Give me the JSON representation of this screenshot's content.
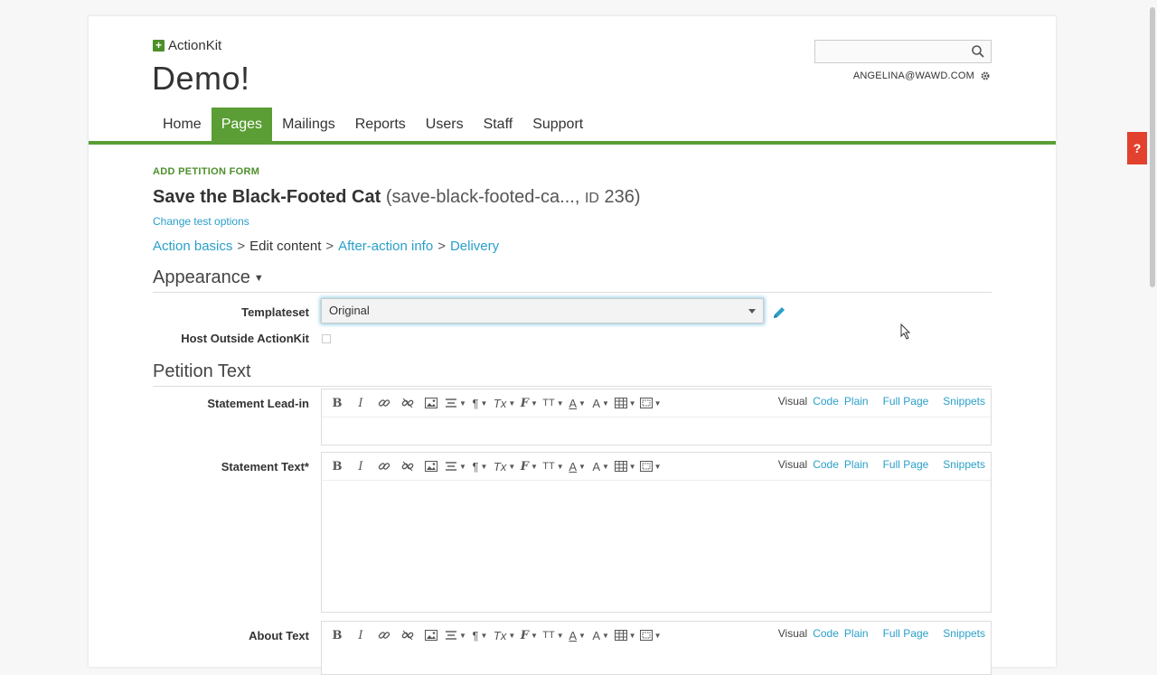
{
  "header": {
    "brand": "ActionKit",
    "brand_mark": "+",
    "site_title": "Demo!",
    "search": {
      "placeholder": "",
      "value": ""
    },
    "user_email": "ANGELINA@WAWD.COM"
  },
  "nav": {
    "items": [
      {
        "label": "Home",
        "active": false
      },
      {
        "label": "Pages",
        "active": true
      },
      {
        "label": "Mailings",
        "active": false
      },
      {
        "label": "Reports",
        "active": false
      },
      {
        "label": "Users",
        "active": false
      },
      {
        "label": "Staff",
        "active": false
      },
      {
        "label": "Support",
        "active": false
      }
    ]
  },
  "page": {
    "form_type": "ADD PETITION FORM",
    "name": "Save the Black-Footed Cat",
    "slug_open": "(save-black-footed-ca..., ",
    "id_label": "ID",
    "id_value": "236)",
    "change_test": "Change test options"
  },
  "breadcrumbs": [
    {
      "label": "Action basics",
      "link": true
    },
    {
      "label": ">",
      "sep": true
    },
    {
      "label": "Edit content",
      "link": false
    },
    {
      "label": ">",
      "sep": true
    },
    {
      "label": "After-action info",
      "link": true
    },
    {
      "label": ">",
      "sep": true
    },
    {
      "label": "Delivery",
      "link": true
    }
  ],
  "appearance": {
    "heading": "Appearance",
    "templateset_label": "Templateset",
    "templateset_value": "Original",
    "host_outside_label": "Host Outside ActionKit",
    "host_outside_checked": false
  },
  "petition_text": {
    "heading": "Petition Text",
    "fields": [
      {
        "label": "Statement Lead-in"
      },
      {
        "label": "Statement Text*"
      },
      {
        "label": "About Text"
      }
    ]
  },
  "editor_toolbar": {
    "bold": "B",
    "italic": "I",
    "paragraph": "¶",
    "clear_format": "Tx",
    "font": "F",
    "font_size": "TT",
    "text_color": "A",
    "bg_color": "A",
    "modes": {
      "visual": "Visual",
      "code": "Code",
      "plain": "Plain",
      "full_page": "Full Page",
      "snippets": "Snippets"
    }
  },
  "help_tab": "?",
  "colors": {
    "accent_green": "#5a9e35",
    "link_blue": "#2a9fc9",
    "help_red": "#e2412d"
  }
}
